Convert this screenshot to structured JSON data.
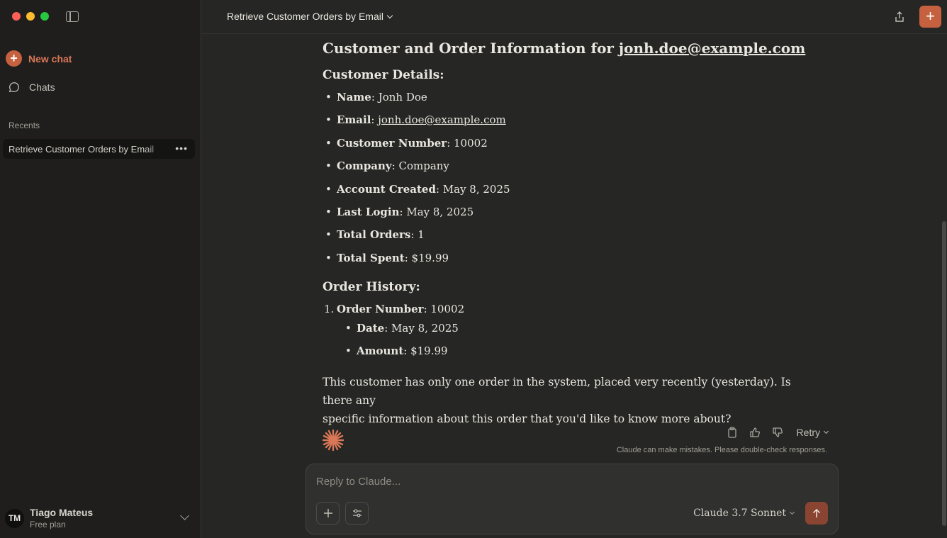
{
  "sidebar": {
    "new_chat": "New chat",
    "chats": "Chats",
    "recents_label": "Recents",
    "recent_items": [
      {
        "label": "Retrieve Customer Orders by Email"
      }
    ],
    "user": {
      "initials": "TM",
      "name": "Tiago Mateus",
      "plan": "Free plan"
    }
  },
  "header": {
    "title": "Retrieve Customer Orders by Email"
  },
  "message": {
    "heading_prefix": "Customer and Order Information for ",
    "heading_email": "jonh.doe@example.com",
    "customer_heading": "Customer Details:",
    "customer_details": [
      {
        "label": "Name",
        "value": "Jonh Doe"
      },
      {
        "label": "Email",
        "value": "jonh.doe@example.com"
      },
      {
        "label": "Customer Number",
        "value": "10002"
      },
      {
        "label": "Company",
        "value": "Company"
      },
      {
        "label": "Account Created",
        "value": "May 8, 2025"
      },
      {
        "label": "Last Login",
        "value": "May 8, 2025"
      },
      {
        "label": "Total Orders",
        "value": "1"
      },
      {
        "label": "Total Spent",
        "value": "$19.99"
      }
    ],
    "order_heading": "Order History:",
    "orders": [
      {
        "num": "1.",
        "label": "Order Number",
        "value": "10002",
        "details": [
          {
            "label": "Date",
            "value": "May 8, 2025"
          },
          {
            "label": "Amount",
            "value": "$19.99"
          }
        ]
      }
    ],
    "closing_line1": "This customer has only one order in the system, placed very recently (yesterday). Is there any",
    "closing_line2": "specific information about this order that you'd like to know more about?"
  },
  "actions": {
    "retry": "Retry",
    "disclaimer": "Claude can make mistakes. Please double-check responses."
  },
  "composer": {
    "placeholder": "Reply to Claude...",
    "model": "Claude 3.7 Sonnet"
  },
  "colors": {
    "accent": "#c6613f",
    "background": "#262624",
    "sidebar": "#1f1e1d"
  }
}
